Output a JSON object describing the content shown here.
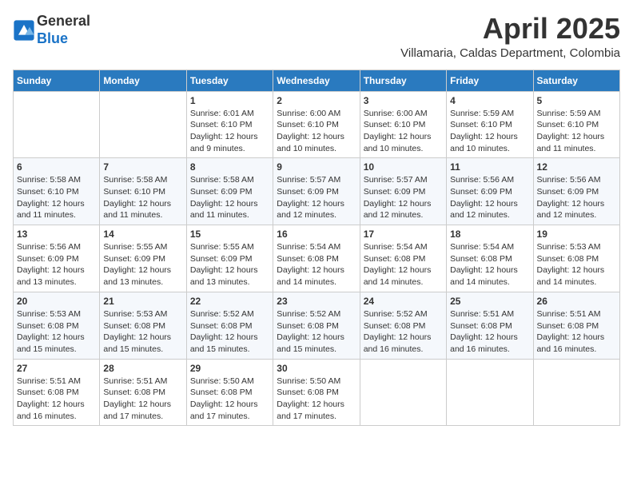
{
  "header": {
    "logo_line1": "General",
    "logo_line2": "Blue",
    "month_year": "April 2025",
    "location": "Villamaria, Caldas Department, Colombia"
  },
  "days_of_week": [
    "Sunday",
    "Monday",
    "Tuesday",
    "Wednesday",
    "Thursday",
    "Friday",
    "Saturday"
  ],
  "weeks": [
    [
      {
        "day": "",
        "info": ""
      },
      {
        "day": "",
        "info": ""
      },
      {
        "day": "1",
        "info": "Sunrise: 6:01 AM\nSunset: 6:10 PM\nDaylight: 12 hours\nand 9 minutes."
      },
      {
        "day": "2",
        "info": "Sunrise: 6:00 AM\nSunset: 6:10 PM\nDaylight: 12 hours\nand 10 minutes."
      },
      {
        "day": "3",
        "info": "Sunrise: 6:00 AM\nSunset: 6:10 PM\nDaylight: 12 hours\nand 10 minutes."
      },
      {
        "day": "4",
        "info": "Sunrise: 5:59 AM\nSunset: 6:10 PM\nDaylight: 12 hours\nand 10 minutes."
      },
      {
        "day": "5",
        "info": "Sunrise: 5:59 AM\nSunset: 6:10 PM\nDaylight: 12 hours\nand 11 minutes."
      }
    ],
    [
      {
        "day": "6",
        "info": "Sunrise: 5:58 AM\nSunset: 6:10 PM\nDaylight: 12 hours\nand 11 minutes."
      },
      {
        "day": "7",
        "info": "Sunrise: 5:58 AM\nSunset: 6:10 PM\nDaylight: 12 hours\nand 11 minutes."
      },
      {
        "day": "8",
        "info": "Sunrise: 5:58 AM\nSunset: 6:09 PM\nDaylight: 12 hours\nand 11 minutes."
      },
      {
        "day": "9",
        "info": "Sunrise: 5:57 AM\nSunset: 6:09 PM\nDaylight: 12 hours\nand 12 minutes."
      },
      {
        "day": "10",
        "info": "Sunrise: 5:57 AM\nSunset: 6:09 PM\nDaylight: 12 hours\nand 12 minutes."
      },
      {
        "day": "11",
        "info": "Sunrise: 5:56 AM\nSunset: 6:09 PM\nDaylight: 12 hours\nand 12 minutes."
      },
      {
        "day": "12",
        "info": "Sunrise: 5:56 AM\nSunset: 6:09 PM\nDaylight: 12 hours\nand 12 minutes."
      }
    ],
    [
      {
        "day": "13",
        "info": "Sunrise: 5:56 AM\nSunset: 6:09 PM\nDaylight: 12 hours\nand 13 minutes."
      },
      {
        "day": "14",
        "info": "Sunrise: 5:55 AM\nSunset: 6:09 PM\nDaylight: 12 hours\nand 13 minutes."
      },
      {
        "day": "15",
        "info": "Sunrise: 5:55 AM\nSunset: 6:09 PM\nDaylight: 12 hours\nand 13 minutes."
      },
      {
        "day": "16",
        "info": "Sunrise: 5:54 AM\nSunset: 6:08 PM\nDaylight: 12 hours\nand 14 minutes."
      },
      {
        "day": "17",
        "info": "Sunrise: 5:54 AM\nSunset: 6:08 PM\nDaylight: 12 hours\nand 14 minutes."
      },
      {
        "day": "18",
        "info": "Sunrise: 5:54 AM\nSunset: 6:08 PM\nDaylight: 12 hours\nand 14 minutes."
      },
      {
        "day": "19",
        "info": "Sunrise: 5:53 AM\nSunset: 6:08 PM\nDaylight: 12 hours\nand 14 minutes."
      }
    ],
    [
      {
        "day": "20",
        "info": "Sunrise: 5:53 AM\nSunset: 6:08 PM\nDaylight: 12 hours\nand 15 minutes."
      },
      {
        "day": "21",
        "info": "Sunrise: 5:53 AM\nSunset: 6:08 PM\nDaylight: 12 hours\nand 15 minutes."
      },
      {
        "day": "22",
        "info": "Sunrise: 5:52 AM\nSunset: 6:08 PM\nDaylight: 12 hours\nand 15 minutes."
      },
      {
        "day": "23",
        "info": "Sunrise: 5:52 AM\nSunset: 6:08 PM\nDaylight: 12 hours\nand 15 minutes."
      },
      {
        "day": "24",
        "info": "Sunrise: 5:52 AM\nSunset: 6:08 PM\nDaylight: 12 hours\nand 16 minutes."
      },
      {
        "day": "25",
        "info": "Sunrise: 5:51 AM\nSunset: 6:08 PM\nDaylight: 12 hours\nand 16 minutes."
      },
      {
        "day": "26",
        "info": "Sunrise: 5:51 AM\nSunset: 6:08 PM\nDaylight: 12 hours\nand 16 minutes."
      }
    ],
    [
      {
        "day": "27",
        "info": "Sunrise: 5:51 AM\nSunset: 6:08 PM\nDaylight: 12 hours\nand 16 minutes."
      },
      {
        "day": "28",
        "info": "Sunrise: 5:51 AM\nSunset: 6:08 PM\nDaylight: 12 hours\nand 17 minutes."
      },
      {
        "day": "29",
        "info": "Sunrise: 5:50 AM\nSunset: 6:08 PM\nDaylight: 12 hours\nand 17 minutes."
      },
      {
        "day": "30",
        "info": "Sunrise: 5:50 AM\nSunset: 6:08 PM\nDaylight: 12 hours\nand 17 minutes."
      },
      {
        "day": "",
        "info": ""
      },
      {
        "day": "",
        "info": ""
      },
      {
        "day": "",
        "info": ""
      }
    ]
  ]
}
